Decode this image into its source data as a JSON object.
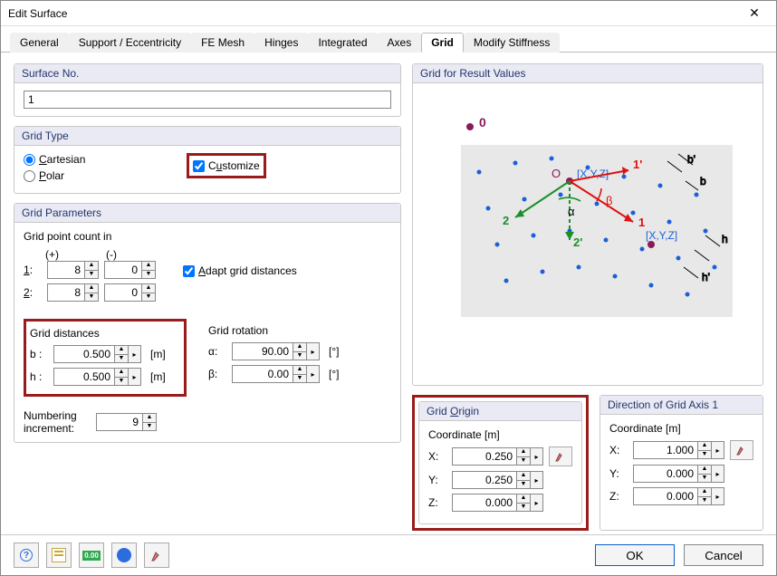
{
  "window": {
    "title": "Edit Surface"
  },
  "tabs": {
    "general": "General",
    "support": "Support / Eccentricity",
    "femesh": "FE Mesh",
    "hinges": "Hinges",
    "integrated": "Integrated",
    "axes": "Axes",
    "grid": "Grid",
    "modstiff": "Modify Stiffness",
    "active": "grid"
  },
  "surface_no": {
    "header": "Surface No.",
    "value": "1"
  },
  "grid_type": {
    "header": "Grid Type",
    "cartesian": "Cartesian",
    "polar": "Polar",
    "customize": "Customize",
    "selected": "cartesian",
    "customize_checked": true
  },
  "grid_params": {
    "header": "Grid Parameters",
    "count_label": "Grid point count in",
    "plus": "(+)",
    "minus": "(-)",
    "row1_label": "1:",
    "row2_label": "2:",
    "row1_plus": "8",
    "row1_minus": "0",
    "row2_plus": "8",
    "row2_minus": "0",
    "adapt_label": "Adapt grid distances",
    "adapt_checked": true,
    "distances_header": "Grid distances",
    "b_label": "b :",
    "h_label": "h :",
    "b_value": "0.500",
    "h_value": "0.500",
    "dist_unit": "[m]",
    "rotation_header": "Grid rotation",
    "alpha_label": "α:",
    "beta_label": "β:",
    "alpha_value": "90.00",
    "beta_value": "0.00",
    "rot_unit": "[°]",
    "numbering_label": "Numbering\nincrement:",
    "numbering_value": "9"
  },
  "preview": {
    "header": "Grid for Result Values"
  },
  "origin": {
    "header": "Grid Origin",
    "coord_label": "Coordinate  [m]",
    "x_label": "X:",
    "y_label": "Y:",
    "z_label": "Z:",
    "x": "0.250",
    "y": "0.250",
    "z": "0.000"
  },
  "axis1": {
    "header": "Direction of Grid Axis 1",
    "coord_label": "Coordinate  [m]",
    "x_label": "X:",
    "y_label": "Y:",
    "z_label": "Z:",
    "x": "1.000",
    "y": "0.000",
    "z": "0.000"
  },
  "footer": {
    "ok": "OK",
    "cancel": "Cancel"
  }
}
